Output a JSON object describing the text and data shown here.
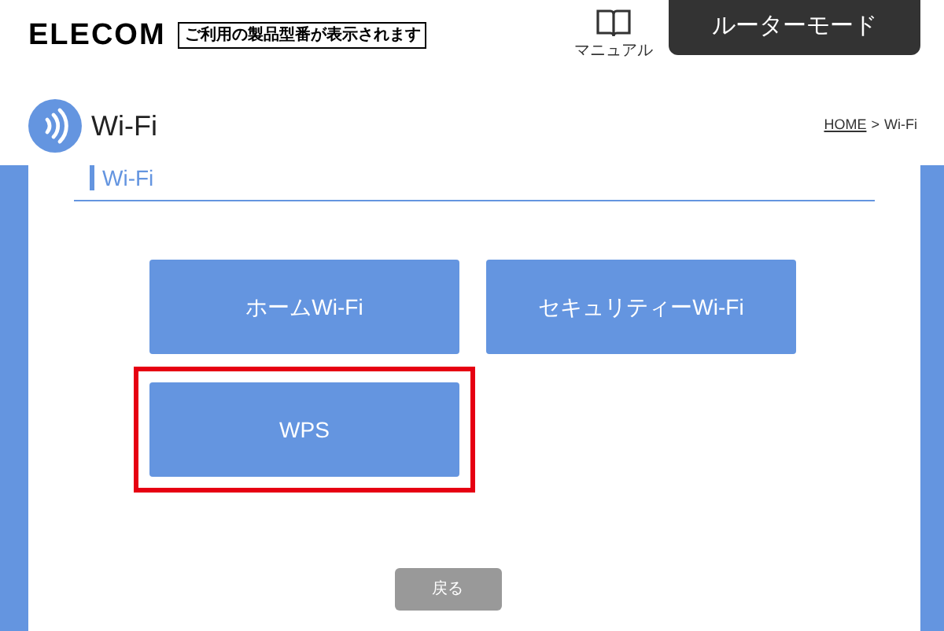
{
  "header": {
    "logo": "ELECOM",
    "model_notice": "ご利用の製品型番が表示されます",
    "manual_label": "マニュアル",
    "mode_button": "ルーターモード"
  },
  "page_title": "Wi-Fi",
  "breadcrumb": {
    "home": "HOME",
    "separator": ">",
    "current": "Wi-Fi"
  },
  "section_heading": "Wi-Fi",
  "menu_buttons": [
    {
      "label": "ホームWi-Fi",
      "highlighted": false
    },
    {
      "label": "セキュリティーWi-Fi",
      "highlighted": false
    },
    {
      "label": "WPS",
      "highlighted": true
    }
  ],
  "back_button": "戻る"
}
